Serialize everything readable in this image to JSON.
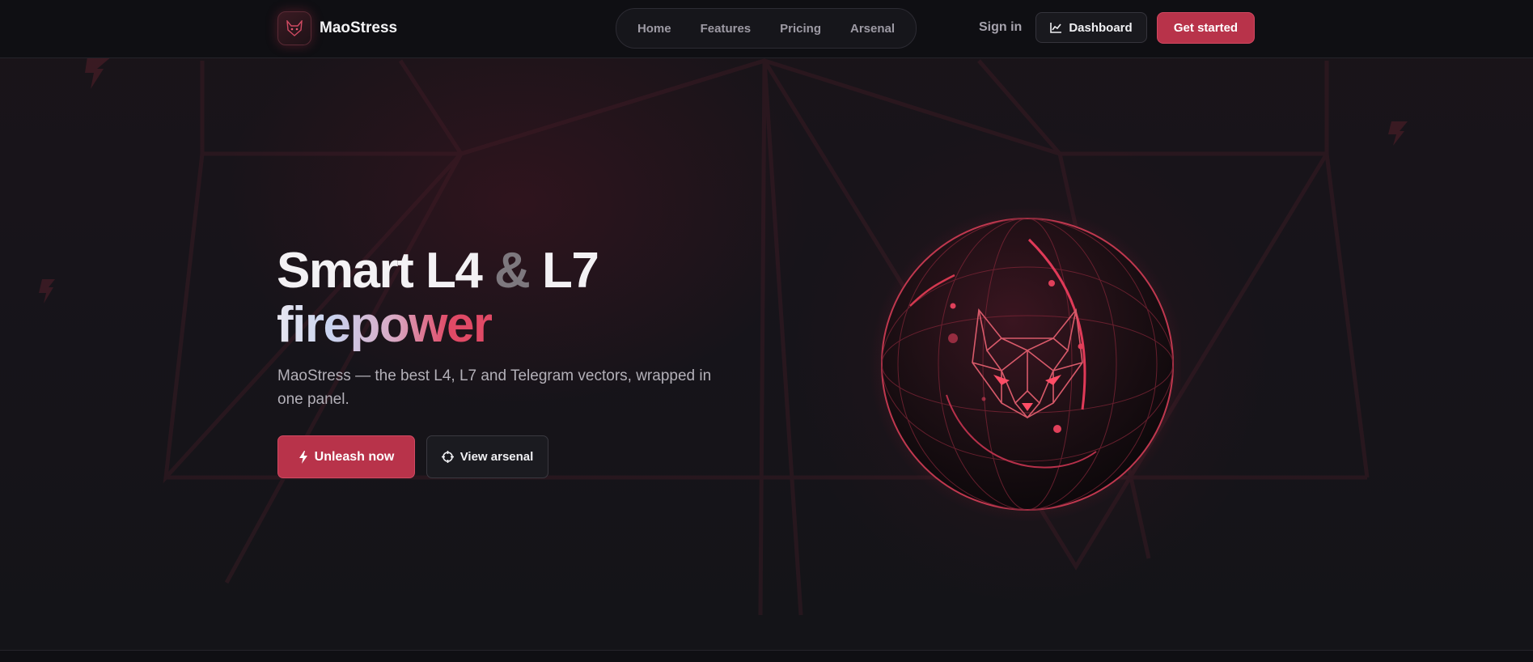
{
  "brand": {
    "name": "MaoStress"
  },
  "nav": {
    "items": [
      {
        "label": "Home"
      },
      {
        "label": "Features"
      },
      {
        "label": "Pricing"
      },
      {
        "label": "Arsenal"
      }
    ]
  },
  "header_actions": {
    "signin_label": "Sign in",
    "dashboard_label": "Dashboard",
    "dashboard_icon": "chart-line-icon",
    "get_started_label": "Get started"
  },
  "hero": {
    "title_part1": "Smart L4 ",
    "title_amp": "&",
    "title_part2": " L7",
    "title_line2": "firepower",
    "subtitle": "MaoStress — the best L4, L7 and Telegram vectors, wrapped in one panel.",
    "primary_cta": "Unleash now",
    "primary_cta_icon": "lightning-icon",
    "secondary_cta": "View arsenal",
    "secondary_cta_icon": "crosshair-icon"
  },
  "colors": {
    "accent": "#b8334a",
    "background": "#131318",
    "header_bg": "#0f0f13",
    "text_muted": "#b3b0b8"
  }
}
